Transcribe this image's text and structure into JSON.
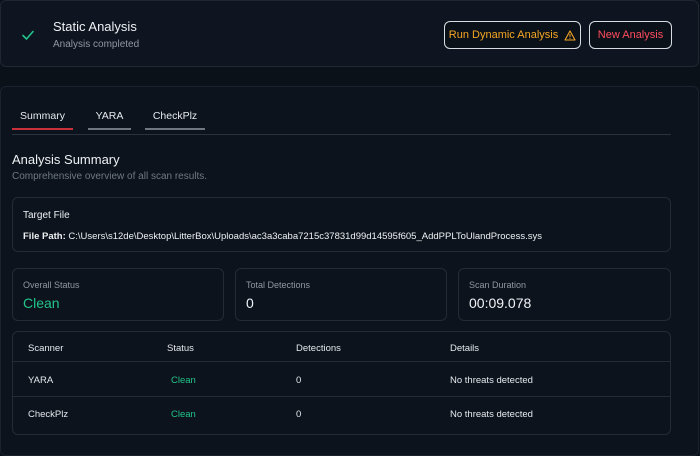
{
  "header": {
    "title": "Static Analysis",
    "subtitle": "Analysis completed",
    "status_icon": "check-icon",
    "buttons": {
      "dynamic_label": "Run Dynamic Analysis",
      "dynamic_icon": "warning-icon",
      "new_label": "New Analysis"
    }
  },
  "tabs": [
    {
      "label": "Summary",
      "active": true
    },
    {
      "label": "YARA",
      "active": false
    },
    {
      "label": "CheckPlz",
      "active": false
    }
  ],
  "summary": {
    "title": "Analysis Summary",
    "subtitle": "Comprehensive overview of all scan results."
  },
  "target_file": {
    "heading": "Target File",
    "path_label": "File Path:",
    "path": "C:\\Users\\s12de\\Desktop\\LitterBox\\Uploads\\ac3a3caba7215c37831d99d14595f605_AddPPLToUlandProcess.sys"
  },
  "stats": {
    "overall_status": {
      "label": "Overall Status",
      "value": "Clean"
    },
    "total_detections": {
      "label": "Total Detections",
      "value": "0"
    },
    "scan_duration": {
      "label": "Scan Duration",
      "value": "00:09.078"
    }
  },
  "results_table": {
    "columns": [
      "Scanner",
      "Status",
      "Detections",
      "Details"
    ],
    "rows": [
      [
        "YARA",
        "Clean",
        "0",
        "No threats detected"
      ],
      [
        "CheckPlz",
        "Clean",
        "0",
        "No threats detected"
      ]
    ]
  },
  "colors": {
    "background": "#0b1119",
    "clean": "#22c48a",
    "warning": "#f5a623",
    "danger": "#ff4d5e",
    "active_tab": "#c8303c"
  }
}
